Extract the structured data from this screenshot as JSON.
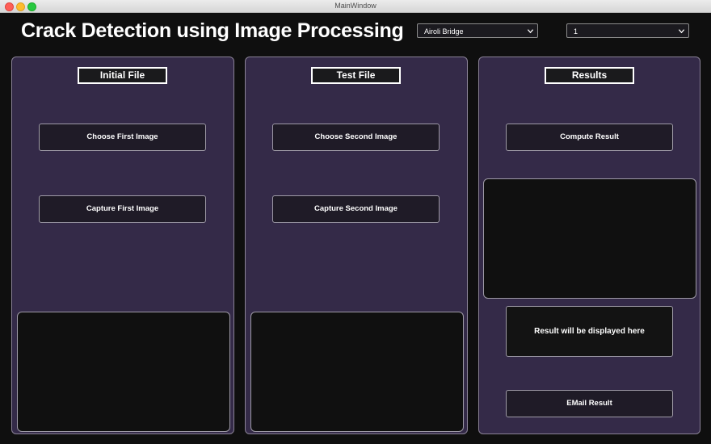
{
  "window": {
    "title": "MainWindow"
  },
  "app": {
    "title": "Crack Detection using Image Processing"
  },
  "selects": {
    "location": {
      "value": "Airoli Bridge"
    },
    "number": {
      "value": "1"
    }
  },
  "panels": {
    "initial": {
      "header": "Initial File",
      "choose_label": "Choose First Image",
      "capture_label": "Capture First Image"
    },
    "test": {
      "header": "Test File",
      "choose_label": "Choose Second Image",
      "capture_label": "Capture Second Image"
    },
    "results": {
      "header": "Results",
      "compute_label": "Compute Result",
      "result_text": "Result will be displayed here",
      "email_label": "EMail Result"
    }
  },
  "colors": {
    "background": "#0f0f0f",
    "panel": "#342a48",
    "button": "#1f1b27",
    "image_area": "#101010"
  },
  "icons": [
    "chevron-down-icon"
  ]
}
